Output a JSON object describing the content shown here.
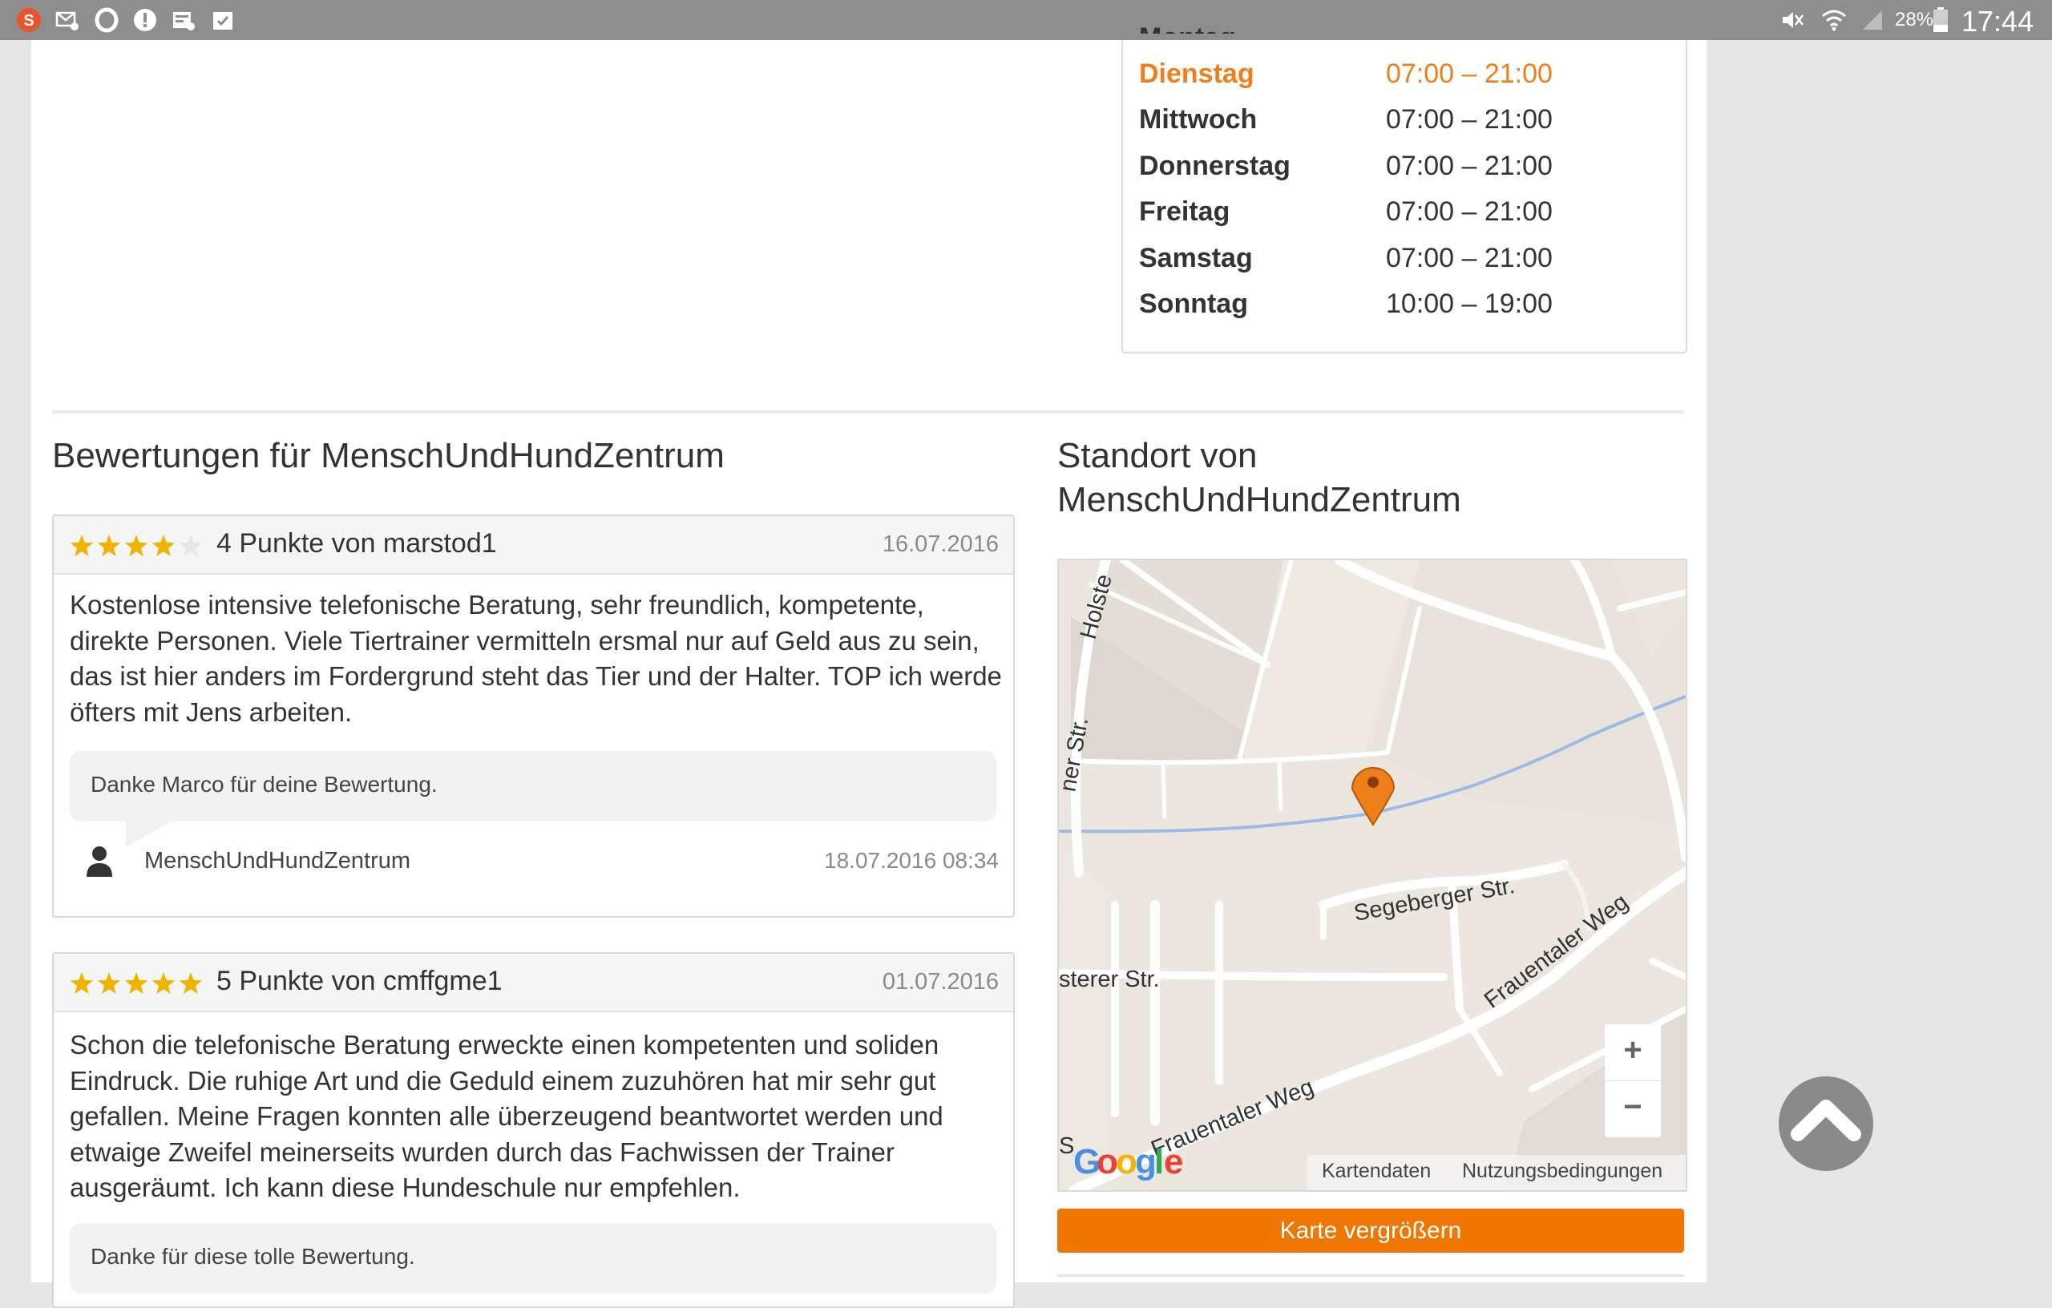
{
  "status_bar": {
    "battery": "28%",
    "time": "17:44",
    "left_icons": [
      "app-s-icon",
      "mail-icon",
      "opera-icon",
      "alert-icon",
      "news-icon",
      "clipboard-check-icon"
    ],
    "right_icons": [
      "mute-icon",
      "wifi-icon",
      "signal-icon",
      "battery-icon"
    ]
  },
  "hours": {
    "days": [
      {
        "day": "Dienstag",
        "time": "07:00 – 21:00",
        "today": true
      },
      {
        "day": "Mittwoch",
        "time": "07:00 – 21:00",
        "today": false
      },
      {
        "day": "Donnerstag",
        "time": "07:00 – 21:00",
        "today": false
      },
      {
        "day": "Freitag",
        "time": "07:00 – 21:00",
        "today": false
      },
      {
        "day": "Samstag",
        "time": "07:00 – 21:00",
        "today": false
      },
      {
        "day": "Sonntag",
        "time": "10:00 – 19:00",
        "today": false
      }
    ],
    "today_color": "#ef7f1a"
  },
  "reviews_section": {
    "title": "Bewertungen für MenschUndHundZentrum",
    "reviews": [
      {
        "stars": 4,
        "max_stars": 5,
        "title": "4 Punkte von marstod1",
        "date": "16.07.2016",
        "body": "Kostenlose intensive telefonische Beratung, sehr freundlich, kompetente, direkte Personen. Viele Tiertrainer vermitteln ersmal nur auf Geld aus zu sein, das ist hier anders im Fordergrund steht das Tier und der Halter. TOP ich werde öfters mit Jens arbeiten.",
        "reply": "Danke Marco für deine Bewertung.",
        "reply_author": "MenschUndHundZentrum",
        "reply_date": "18.07.2016 08:34"
      },
      {
        "stars": 5,
        "max_stars": 5,
        "title": "5 Punkte von cmffgme1",
        "date": "01.07.2016",
        "body": "Schon die telefonische Beratung erweckte einen kompetenten und soliden Eindruck. Die ruhige Art und die Geduld einem zuzuhören hat mir sehr gut gefallen. Meine Fragen konnten alle überzeugend beantwortet werden und etwaige Zweifel meinerseits wurden durch das Fachwissen der Trainer ausgeräumt. Ich kann diese Hundeschule nur empfehlen.",
        "reply": "Danke für diese tolle Bewertung."
      }
    ],
    "star_color": "#f0b400"
  },
  "location": {
    "title_line1": "Standort von",
    "title_line2": "MenschUndHundZentrum",
    "map": {
      "streets": [
        "Holste",
        "ner Str.",
        "Segeberger Str.",
        "Frauentaler Weg",
        "sterer Str.",
        "Frauentaler Weg",
        "S"
      ],
      "zoom_in": "+",
      "zoom_out": "−",
      "attribution_data": "Kartendaten",
      "attribution_terms": "Nutzungsbedingungen",
      "logo": "Google"
    },
    "enlarge_button": "Karte vergrößern",
    "button_color": "#ef7600"
  },
  "scroll_top_icon": "chevron-up-icon"
}
